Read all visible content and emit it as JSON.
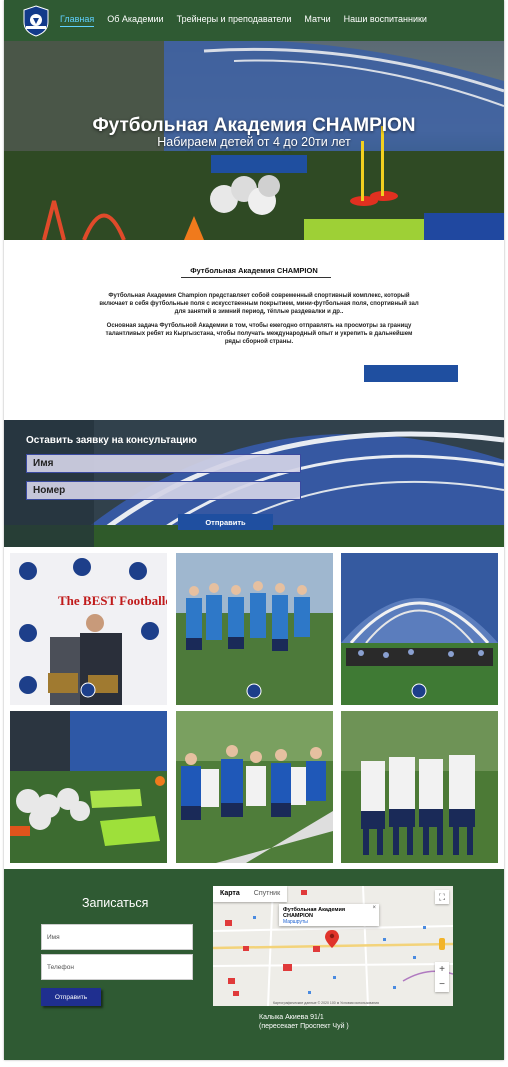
{
  "nav": {
    "items": [
      {
        "label": "Главная",
        "active": true
      },
      {
        "label": "Об Академии",
        "active": false
      },
      {
        "label": "Трейнеры и преподаватели",
        "active": false
      },
      {
        "label": "Матчи",
        "active": false
      },
      {
        "label": "Наши воспитанники",
        "active": false
      }
    ]
  },
  "hero": {
    "title": "Футбольная Академия CHAMPION",
    "subtitle": "Набираем детей от 4 до 20ти лет"
  },
  "about": {
    "title": "Футбольная Академия CHAMPION",
    "paragraph1": "Футбольная Академия Champion представляет собой современный спортивный комплекс, который включает в себя футбольные поля с искусственным покрытием, мини-футбольная поля, спортивный зал для занятий в зимний период, тёплые раздевалки и др..",
    "paragraph2": "Основная задача Футбольной Академии в том, чтобы ежегодно отправлять на просмотры за границу талантливых ребят из Кыргызстана, чтобы получать международный опыт и укрепить в дальнейшем ряды сборной страны."
  },
  "consult": {
    "title": "Оставить заявку на консультацию",
    "name_placeholder": "Имя",
    "phone_placeholder": "Номер",
    "submit_label": "Отправить"
  },
  "gallery": {
    "photo1_text": "The BEST Footballer"
  },
  "footer": {
    "title": "Записаться",
    "name_placeholder": "Имя",
    "phone_placeholder": "Телефон",
    "submit_label": "Отправить",
    "map": {
      "tab_map": "Карта",
      "tab_satellite": "Спутник",
      "popup_title": "Футбольная Академия CHAMPION",
      "popup_link": "Маршруты",
      "attribution": "Картографические данные © 2020   100 м   Условия использования"
    },
    "address_line1": "Калыка Акиева 91/1",
    "address_line2": "(пересекает Проспект Чуй )"
  },
  "colors": {
    "nav_bg": "#2f5a33",
    "accent_blue": "#1f4fa0",
    "active_link": "#5fd0ff"
  }
}
